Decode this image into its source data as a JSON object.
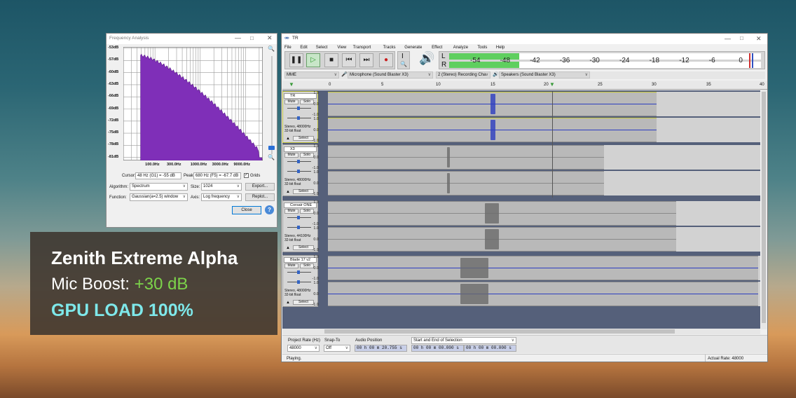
{
  "freq_window": {
    "title": "Frequency Analysis",
    "db_ticks": [
      "-53dB",
      "-57dB",
      "-60dB",
      "-63dB",
      "-66dB",
      "-69dB",
      "-72dB",
      "-75dB",
      "-78dB",
      "-81dB"
    ],
    "freq_ticks": [
      "100.0Hz",
      "300.0Hz",
      "1000.0Hz",
      "3000.0Hz",
      "9000.0Hz"
    ],
    "cursor_label": "Cursor:",
    "cursor_value": "48 Hz (G1) = -55 dB",
    "peak_label": "Peak:",
    "peak_value": "680 Hz (F5) = -67.7 dB",
    "grids_label": "Grids",
    "algorithm_label": "Algorithm:",
    "algorithm_value": "Spectrum",
    "size_label": "Size:",
    "size_value": "1024",
    "export_label": "Export...",
    "function_label": "Function:",
    "function_value": "Gaussian(a=2.5) window",
    "axis_label": "Axis:",
    "axis_value": "Log frequency",
    "replot_label": "Replot...",
    "close_label": "Close",
    "help_label": "?",
    "plot_color": "#7f2fb8"
  },
  "audacity": {
    "title": "TR",
    "menu": [
      "File",
      "Edit",
      "Select",
      "View",
      "Transport",
      "Tracks",
      "Generate",
      "Effect",
      "Analyze",
      "Tools",
      "Help"
    ],
    "meter_labels": [
      "-54",
      "-48",
      "-42",
      "-36",
      "-30",
      "-24",
      "-18",
      "-12",
      "-6",
      "0"
    ],
    "meter_l": "L",
    "meter_r": "R",
    "host": "MME",
    "mic_device": "Microphone (Sound Blaster X3)",
    "channels": "2 (Stereo) Recording Cha",
    "speaker_device": "Speakers (Sound Blaster X3)",
    "ruler": [
      "0",
      "5",
      "10",
      "15",
      "20",
      "25",
      "30",
      "35",
      "40"
    ],
    "tracks": [
      {
        "name": "TR",
        "info1": "Stereo, 48000Hz",
        "info2": "32-bit float"
      },
      {
        "name": "X3",
        "info1": "Stereo, 48000Hz",
        "info2": "32-bit float"
      },
      {
        "name": "Corsair ONE",
        "info1": "Stereo, 44100Hz",
        "info2": "32-bit float"
      },
      {
        "name": "Blade 17 v2",
        "info1": "Stereo, 48000Hz",
        "info2": "32-bit float"
      }
    ],
    "mute_label": "Mute",
    "solo_label": "Solo",
    "select_label": "Select",
    "scale_labels": [
      "1.0",
      "0.0",
      "-1.0"
    ],
    "project_rate_label": "Project Rate (Hz)",
    "project_rate_value": "48000",
    "snap_label": "Snap-To",
    "snap_value": "Off",
    "audio_position_label": "Audio Position",
    "audio_position_value": "00 h 00 m 20.755 s",
    "selection_label": "Start and End of Selection",
    "selection_start": "00 h 00 m 00.000 s",
    "selection_end": "00 h 00 m 00.000 s",
    "status": "Playing.",
    "actual_rate": "Actual Rate: 48000"
  },
  "overlay": {
    "line1": "Zenith Extreme Alpha",
    "line2_prefix": "Mic Boost: ",
    "line2_value": "+30 dB",
    "line3": "GPU LOAD 100%",
    "green": "#7cd34a",
    "cyan": "#7ee8ea"
  }
}
